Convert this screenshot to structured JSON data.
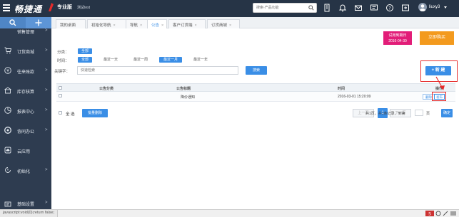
{
  "topbar": {
    "logo_text": "畅捷通",
    "edition": "专业版",
    "company": "测试test",
    "search_placeholder": "搜索-产品功能",
    "username": "liuxy3"
  },
  "sidebar": {
    "items": [
      {
        "label": "销售管理",
        "icon": "sales-icon"
      },
      {
        "label": "订货商城",
        "icon": "cart-icon"
      },
      {
        "label": "往来账款",
        "icon": "yen-circle-icon"
      },
      {
        "label": "库存核算",
        "icon": "warehouse-icon"
      },
      {
        "label": "报表中心",
        "icon": "chart-icon"
      },
      {
        "label": "协同办公",
        "icon": "collab-icon"
      },
      {
        "label": "云应用",
        "icon": "cloud-icon"
      },
      {
        "label": "初始化",
        "icon": "init-icon"
      },
      {
        "label": "基础设置",
        "icon": "settings-icon"
      }
    ]
  },
  "tabs": [
    {
      "label": "我的桌面",
      "closable": false
    },
    {
      "label": "初始化导航",
      "closable": true
    },
    {
      "label": "导航",
      "closable": true
    },
    {
      "label": "公告",
      "closable": true,
      "active": true
    },
    {
      "label": "客户订货端",
      "closable": true
    },
    {
      "label": "订货商城",
      "closable": true
    }
  ],
  "trial": {
    "line1": "试用到期日",
    "line2": "2016-04-30"
  },
  "buy_label": "立即购买",
  "filters": {
    "category_label": "分类：",
    "category_all": "全部",
    "time_label": "时间：",
    "time_options": [
      "全部",
      "最近一天",
      "最近一周",
      "最近一月",
      "最近一年"
    ],
    "time_selected": "最近一月",
    "keyword_label": "关键字：",
    "keyword_placeholder": "快速检索",
    "search_label": "搜索"
  },
  "new_label": "+ 新 建",
  "table": {
    "columns": [
      "公告分类",
      "公告标题",
      "时间",
      "操作"
    ],
    "rows": [
      {
        "category": "",
        "title": "降价通知",
        "time": "2016-03-01 15:20:09",
        "actions": [
          "删除",
          "发布"
        ]
      }
    ]
  },
  "footer": {
    "select_all": "全 选",
    "bulk_delete": "批量删除",
    "prev": "上一页",
    "current_page": "1",
    "next": "下一页",
    "page_info": "共1页，共1条记录，到第",
    "page_unit": "页",
    "go": "确定"
  },
  "statusbar": {
    "url": "javascript:void(0);return false;"
  },
  "colors": {
    "accent": "#3a8ee6",
    "topbar": "#263446",
    "sidebar": "#2e3c50",
    "trial": "#e21d78",
    "buy": "#f39a1e",
    "highlight": "#e62b2b"
  }
}
